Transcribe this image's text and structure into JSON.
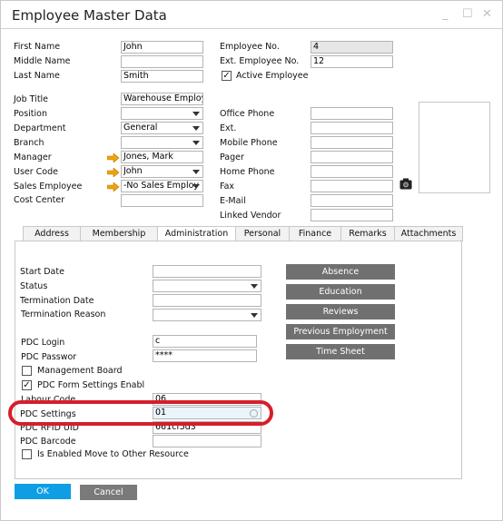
{
  "window": {
    "title": "Employee Master Data",
    "controls": {
      "minimize": "_",
      "maximize": "☐",
      "close": "✕"
    }
  },
  "header_left": {
    "first_name": {
      "label": "First Name",
      "value": "John"
    },
    "middle_name": {
      "label": "Middle Name",
      "value": ""
    },
    "last_name": {
      "label": "Last Name",
      "value": "Smith"
    }
  },
  "header_right": {
    "employee_no": {
      "label": "Employee No.",
      "value": "4"
    },
    "ext_employee_no": {
      "label": "Ext. Employee No.",
      "value": "12"
    },
    "active_employee": {
      "label": "Active Employee",
      "checked": true
    }
  },
  "details_left": {
    "job_title": {
      "label": "Job Title",
      "value": "Warehouse Employ"
    },
    "position": {
      "label": "Position",
      "value": ""
    },
    "department": {
      "label": "Department",
      "value": "General"
    },
    "branch": {
      "label": "Branch",
      "value": ""
    },
    "manager": {
      "label": "Manager",
      "value": "Jones, Mark"
    },
    "user_code": {
      "label": "User Code",
      "value": "John"
    },
    "sales_employee": {
      "label": "Sales Employee",
      "value": "-No Sales Employ"
    },
    "cost_center": {
      "label": "Cost Center",
      "value": ""
    }
  },
  "details_right": {
    "office_phone": {
      "label": "Office Phone",
      "value": ""
    },
    "ext": {
      "label": "Ext.",
      "value": ""
    },
    "mobile_phone": {
      "label": "Mobile Phone",
      "value": ""
    },
    "pager": {
      "label": "Pager",
      "value": ""
    },
    "home_phone": {
      "label": "Home Phone",
      "value": ""
    },
    "fax": {
      "label": "Fax",
      "value": ""
    },
    "email": {
      "label": "E-Mail",
      "value": ""
    },
    "linked_vendor": {
      "label": "Linked Vendor",
      "value": ""
    }
  },
  "tabs": [
    {
      "label": "Address",
      "active": false
    },
    {
      "label": "Membership",
      "active": false
    },
    {
      "label": "Administration",
      "active": true
    },
    {
      "label": "Personal",
      "active": false
    },
    {
      "label": "Finance",
      "active": false
    },
    {
      "label": "Remarks",
      "active": false
    },
    {
      "label": "Attachments",
      "active": false
    }
  ],
  "administration": {
    "start_date": {
      "label": "Start Date",
      "value": ""
    },
    "status": {
      "label": "Status",
      "value": ""
    },
    "termination_date": {
      "label": "Termination Date",
      "value": ""
    },
    "termination_reason": {
      "label": "Termination Reason",
      "value": ""
    },
    "pdc_login": {
      "label": "PDC Login",
      "value": "c"
    },
    "pdc_password": {
      "label": "PDC Passwor",
      "value": "****"
    },
    "management_board": {
      "label": "Management Board",
      "checked": false
    },
    "pdc_form_settings": {
      "label": "PDC Form Settings Enabl",
      "checked": true
    },
    "labour_code": {
      "label": "Labour Code",
      "value": "06"
    },
    "pdc_settings": {
      "label": "PDC Settings",
      "value": "01"
    },
    "pdc_rfid_uid": {
      "label": "PDC RFID UID",
      "value": "661cf5d3"
    },
    "pdc_barcode": {
      "label": "PDC Barcode",
      "value": ""
    },
    "move_to_other_resource": {
      "label": "Is Enabled Move to Other Resource",
      "checked": false
    },
    "buttons": [
      "Absence",
      "Education",
      "Reviews",
      "Previous Employment",
      "Time Sheet"
    ]
  },
  "footer": {
    "ok": "OK",
    "cancel": "Cancel"
  },
  "colors": {
    "ok_button": "#0f9ee4",
    "highlight_oval": "#d51f2b",
    "arrow": "#f0a30a"
  }
}
